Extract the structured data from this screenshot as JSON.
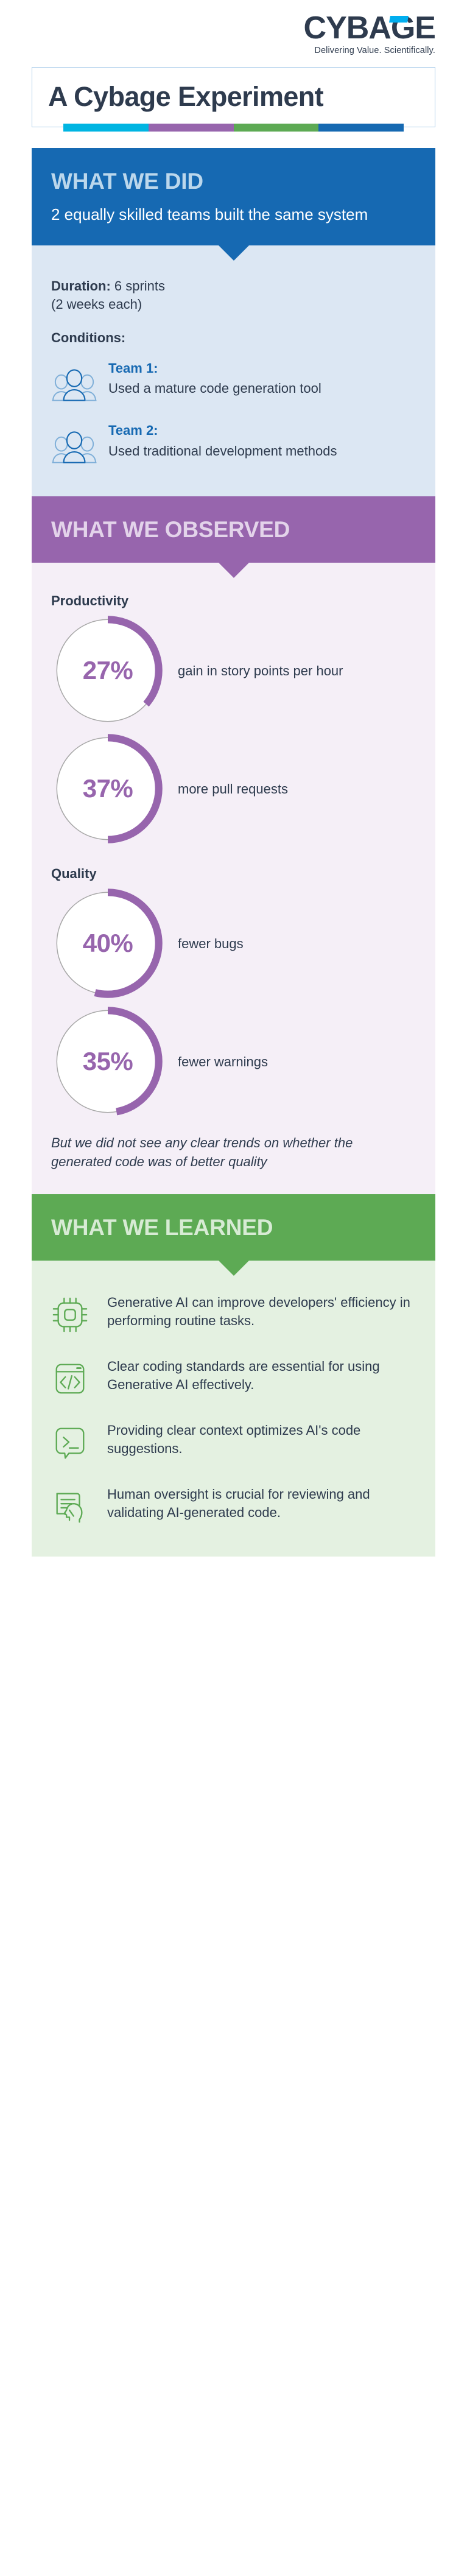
{
  "brand": {
    "logo_text": "CYBAGE",
    "logo_tagline": "Delivering Value. Scientifically.",
    "accent_color": "#00AEEF",
    "logo_color": "#2E3B4E"
  },
  "title": {
    "text": "A Cybage Experiment",
    "bar_colors": [
      "#00B5E2",
      "#9765AD",
      "#5DAA54",
      "#1669B2"
    ]
  },
  "what_we_did": {
    "heading": "WHAT WE DID",
    "subheading": "2 equally skilled teams built the same system",
    "band_color": "#1669B2",
    "body_color": "#DCE7F3",
    "duration_label": "Duration:",
    "duration_value": " 6 sprints",
    "duration_note": "(2 weeks each)",
    "conditions_label": "Conditions:",
    "teams": [
      {
        "name": "Team 1:",
        "desc": "Used a mature code generation tool",
        "icon": "team-group-icon"
      },
      {
        "name": "Team 2:",
        "desc": "Used traditional development methods",
        "icon": "team-group-icon"
      }
    ]
  },
  "what_we_observed": {
    "heading": "WHAT WE OBSERVED",
    "band_color": "#9765AD",
    "body_color": "#F5EFF7",
    "groups": [
      {
        "label": "Productivity",
        "stats": [
          {
            "value": "27%",
            "percent": 27,
            "caption": "gain in story points per hour"
          },
          {
            "value": "37%",
            "percent": 37,
            "caption": "more pull requests"
          }
        ]
      },
      {
        "label": "Quality",
        "stats": [
          {
            "value": "40%",
            "percent": 40,
            "caption": "fewer bugs"
          },
          {
            "value": "35%",
            "percent": 35,
            "caption": "fewer warnings"
          }
        ]
      }
    ],
    "note": "But we did not see any clear trends on whether the generated code was of better quality"
  },
  "what_we_learned": {
    "heading": "WHAT WE LEARNED",
    "band_color": "#5DAA54",
    "body_color": "#E4F1E1",
    "items": [
      {
        "icon": "chip-icon",
        "text": "Generative AI can improve developers' efficiency in performing routine tasks."
      },
      {
        "icon": "code-window-icon",
        "text": "Clear coding standards are essential for using Generative AI effectively."
      },
      {
        "icon": "terminal-bubble-icon",
        "text": "Providing clear context optimizes AI's code suggestions."
      },
      {
        "icon": "document-head-icon",
        "text": "Human oversight is crucial for reviewing and validating AI-generated code."
      }
    ]
  },
  "chart_data": {
    "type": "pie",
    "title": "What We Observed",
    "series": [
      {
        "name": "gain in story points per hour",
        "group": "Productivity",
        "value": 27,
        "unit": "%"
      },
      {
        "name": "more pull requests",
        "group": "Productivity",
        "value": 37,
        "unit": "%"
      },
      {
        "name": "fewer bugs",
        "group": "Quality",
        "value": 40,
        "unit": "%"
      },
      {
        "name": "fewer warnings",
        "group": "Quality",
        "value": 35,
        "unit": "%"
      }
    ],
    "arc_color": "#9765AD",
    "track_color": "#BBBBBB",
    "ylim": [
      0,
      100
    ],
    "legend": "none",
    "grid": false
  }
}
